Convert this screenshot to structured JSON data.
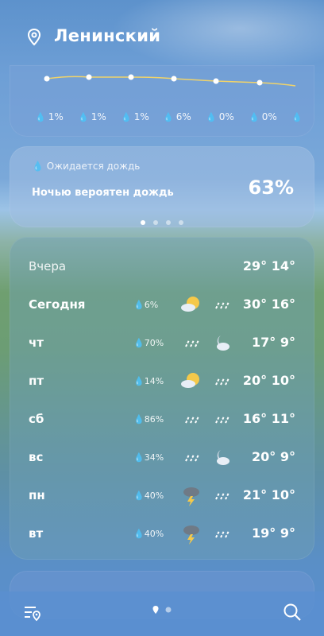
{
  "header": {
    "city": "Ленинский"
  },
  "hourly": {
    "precip": [
      "1%",
      "1%",
      "1%",
      "6%",
      "0%",
      "0%"
    ]
  },
  "rain": {
    "subtitle": "Ожидается дождь",
    "main": "Ночью вероятен дождь",
    "percent": "63%"
  },
  "forecast": {
    "rows": [
      {
        "day": "Вчера",
        "precip": "",
        "icon1": "",
        "icon2": "",
        "temps": "29° 14°"
      },
      {
        "day": "Сегодня",
        "precip": "6%",
        "icon1": "sun-cloud-icon",
        "icon2": "rain-icon",
        "temps": "30° 16°"
      },
      {
        "day": "чт",
        "precip": "70%",
        "icon1": "rain-icon",
        "icon2": "moon-cloud-icon",
        "temps": "17°  9°"
      },
      {
        "day": "пт",
        "precip": "14%",
        "icon1": "sun-cloud-icon",
        "icon2": "rain-icon",
        "temps": "20° 10°"
      },
      {
        "day": "сб",
        "precip": "86%",
        "icon1": "rain-icon",
        "icon2": "rain-icon",
        "temps": "16° 11°"
      },
      {
        "day": "вс",
        "precip": "34%",
        "icon1": "rain-icon",
        "icon2": "moon-cloud-icon",
        "temps": "20°  9°"
      },
      {
        "day": "пн",
        "precip": "40%",
        "icon1": "thunderstorm-icon",
        "icon2": "rain-icon",
        "temps": "21° 10°"
      },
      {
        "day": "вт",
        "precip": "40%",
        "icon1": "thunderstorm-icon",
        "icon2": "rain-icon",
        "temps": "19°  9°"
      }
    ]
  },
  "icons": {
    "location": "location-pin-icon",
    "locations_list": "location-list-icon",
    "search": "search-icon"
  },
  "colors": {
    "accent": "#f5c94a"
  }
}
